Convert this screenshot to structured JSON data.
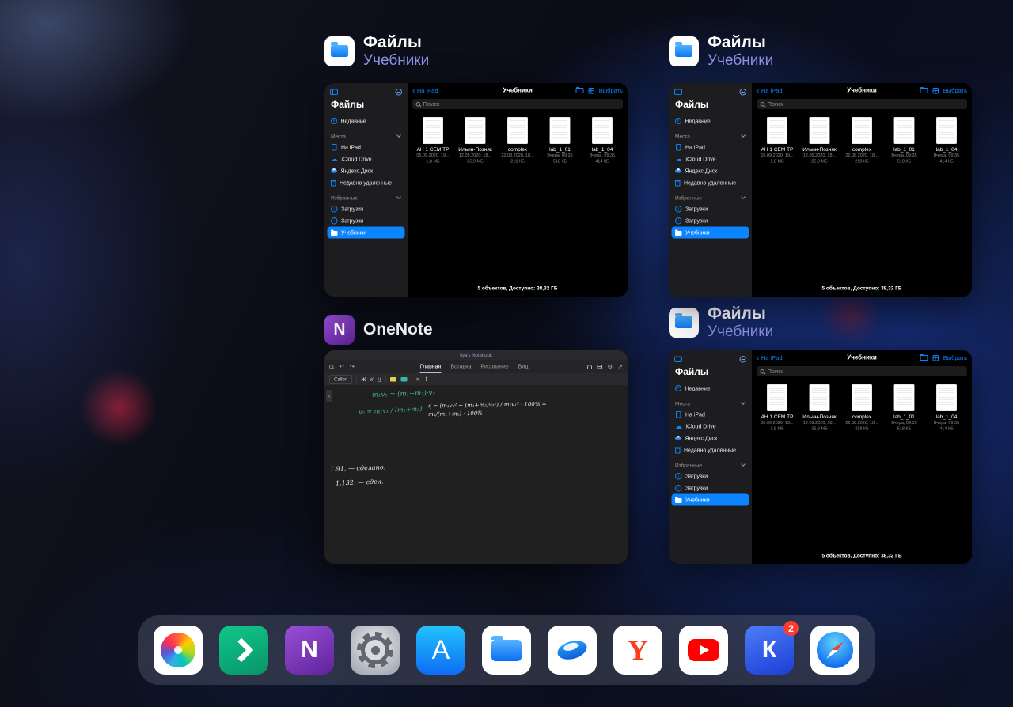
{
  "switcher": {
    "cards": [
      {
        "app": "Файлы",
        "subtitle": "Учебники"
      },
      {
        "app": "Файлы",
        "subtitle": "Учебники"
      },
      {
        "app": "OneNote",
        "subtitle": ""
      },
      {
        "app": "Файлы",
        "subtitle": "Учебники"
      }
    ]
  },
  "files_app": {
    "sidebar": {
      "title": "Файлы",
      "recent": "Недавние",
      "places_header": "Места",
      "places": [
        {
          "label": "На iPad"
        },
        {
          "label": "iCloud Drive"
        },
        {
          "label": "Яндекс.Диск"
        },
        {
          "label": "Недавно удаленные"
        }
      ],
      "favorites_header": "Избранные",
      "favorites": [
        {
          "label": "Загрузки"
        },
        {
          "label": "Загрузки"
        },
        {
          "label": "Учебники"
        }
      ]
    },
    "nav": {
      "back": "На iPad",
      "title": "Учебники",
      "select": "Выбрать"
    },
    "search_placeholder": "Поиск",
    "files": [
      {
        "name": "АН 1 СЕМ ТР",
        "date": "05.09.2020, 19...",
        "size": "1,8 МБ"
      },
      {
        "name": "Ильин-Позняк",
        "date": "12.09.2020, 18...",
        "size": "25,9 МБ"
      },
      {
        "name": "complex",
        "date": "22.08.2020, 18...",
        "size": "218 КБ"
      },
      {
        "name": "lab_1_01",
        "date": "Вчера, 09:35",
        "size": "518 КБ"
      },
      {
        "name": "lab_1_04",
        "date": "Вчера, 09:35",
        "size": "414 КБ"
      }
    ],
    "status": "5 объектов, Доступно: 38,32 ГБ"
  },
  "onenote": {
    "notebook_title": "Ilya's Notebook",
    "tabs": [
      {
        "label": "Главная",
        "selected": true
      },
      {
        "label": "Вставка"
      },
      {
        "label": "Рисование"
      },
      {
        "label": "Вид"
      }
    ],
    "font_name": "Calibri",
    "notes": [
      "m₁v₁ = (m₁+m₂)·v₂",
      "v₂ = m₁v₁ / (m₁+m₂)",
      "η = (m₁v₁² − (m₁+m₂)v₂²) / m₁v₁² · 100% = m₂/(m₁+m₂) · 100%",
      "1.91. — сделано.",
      "1.132. — сдел."
    ]
  },
  "icons": {
    "back_chevron": "‹",
    "collapse_chevron": "‹",
    "undo": "↶",
    "redo": "↷",
    "gear": "⚙",
    "share": "↗",
    "bold": "Ж",
    "italic": "К",
    "underline": "Ч"
  },
  "dock": {
    "apps": [
      {
        "name": "photos"
      },
      {
        "name": "green-arrow-app"
      },
      {
        "name": "onenote",
        "glyph": "N"
      },
      {
        "name": "settings"
      },
      {
        "name": "app-store",
        "glyph": "A"
      },
      {
        "name": "files"
      },
      {
        "name": "yandex-disk"
      },
      {
        "name": "yandex",
        "glyph": "Y"
      },
      {
        "name": "youtube"
      },
      {
        "name": "k-app",
        "glyph": "К",
        "badge": "2"
      },
      {
        "name": "safari"
      }
    ]
  },
  "colors": {
    "accent": "#0a84ff",
    "subtitle": "#8f92e6",
    "badge": "#ff3b30"
  }
}
